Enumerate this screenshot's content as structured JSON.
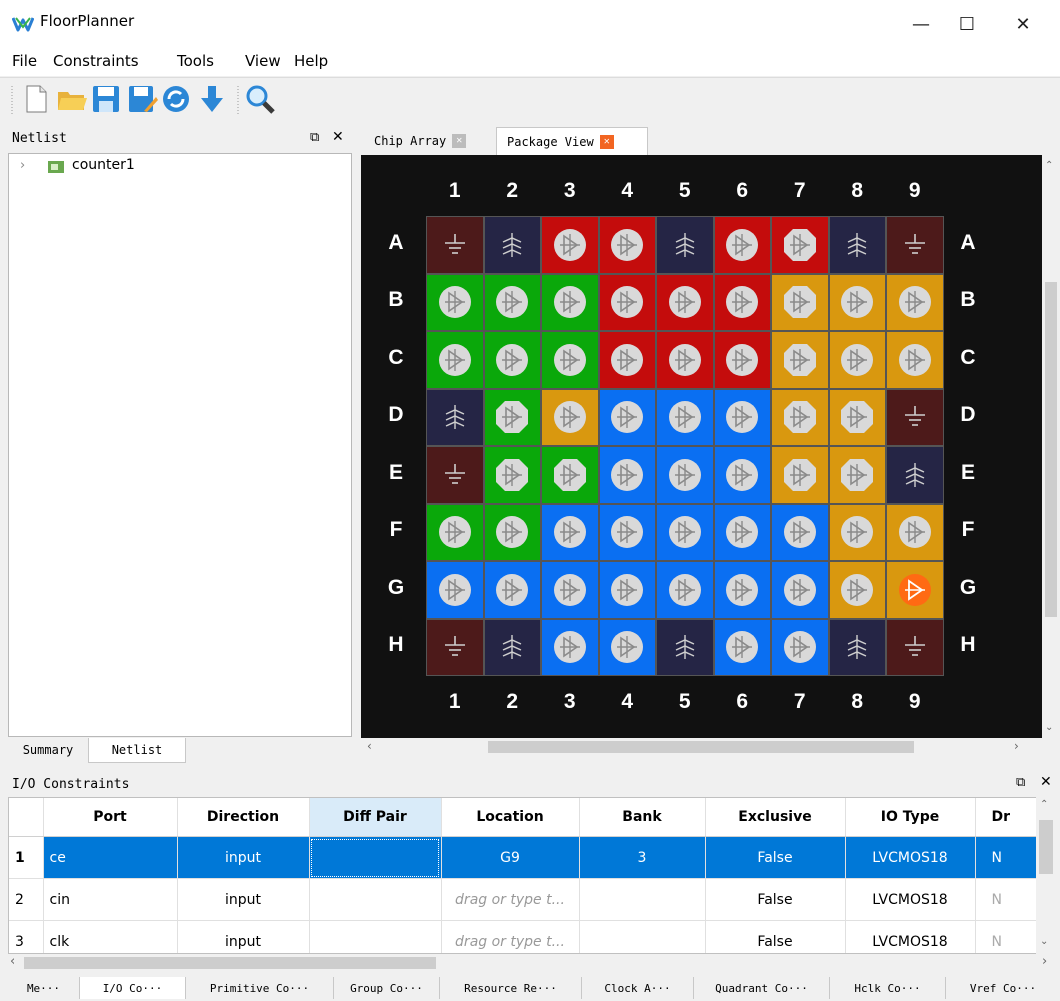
{
  "window": {
    "title": "FloorPlanner",
    "minimize": "—",
    "maximize": "☐",
    "close": "✕"
  },
  "menu": [
    "File",
    "Constraints",
    "Tools",
    "View",
    "Help"
  ],
  "toolbar": [
    "new-file",
    "open-folder",
    "save",
    "save-as",
    "refresh",
    "download",
    "search"
  ],
  "netlist": {
    "title": "Netlist",
    "root_item": "counter1",
    "tabs": [
      "Summary",
      "Netlist"
    ]
  },
  "view_tabs": [
    {
      "label": "Chip Array",
      "active": false
    },
    {
      "label": "Package View",
      "active": true
    }
  ],
  "package": {
    "columns": [
      "1",
      "2",
      "3",
      "4",
      "5",
      "6",
      "7",
      "8",
      "9"
    ],
    "rows": [
      "A",
      "B",
      "C",
      "D",
      "E",
      "F",
      "G",
      "H"
    ],
    "colors": {
      "g": "#4d1a1a",
      "v": "#252545",
      "r": "#c40c0c",
      "G": "#0aa80a",
      "y": "#d9980f",
      "b": "#0a6ff2",
      "o": "#d9980f"
    },
    "grid": [
      [
        "g:gnd",
        "v:pwr",
        "r:io",
        "r:io",
        "v:pwr",
        "r:io",
        "r:cfg",
        "v:pwr",
        "g:gnd"
      ],
      [
        "G:io",
        "G:io",
        "G:io",
        "r:io",
        "r:io",
        "r:io",
        "y:cfg",
        "y:io",
        "y:io"
      ],
      [
        "G:io",
        "G:io",
        "G:io",
        "r:io",
        "r:io",
        "r:io",
        "y:cfg",
        "y:io",
        "y:io"
      ],
      [
        "v:pwr",
        "G:cfg",
        "y:io",
        "b:io",
        "b:io",
        "b:io",
        "y:cfg",
        "y:cfg",
        "g:gnd"
      ],
      [
        "g:gnd",
        "G:cfg",
        "G:cfg",
        "b:io",
        "b:io",
        "b:io",
        "y:cfg",
        "y:cfg",
        "v:pwr"
      ],
      [
        "G:io",
        "G:io",
        "b:io",
        "b:io",
        "b:io",
        "b:io",
        "b:io",
        "y:io",
        "y:io"
      ],
      [
        "b:io",
        "b:io",
        "b:io",
        "b:io",
        "b:io",
        "b:io",
        "b:io",
        "y:io",
        "o:used"
      ],
      [
        "g:gnd",
        "v:pwr",
        "b:io",
        "b:io",
        "v:pwr",
        "b:io",
        "b:io",
        "v:pwr",
        "g:gnd"
      ]
    ]
  },
  "io_constraints": {
    "title": "I/O Constraints",
    "columns": [
      "Port",
      "Direction",
      "Diff Pair",
      "Location",
      "Bank",
      "Exclusive",
      "IO Type",
      "Dr"
    ],
    "rows": [
      {
        "num": "1",
        "port": "ce",
        "direction": "input",
        "diff": "",
        "location": "G9",
        "bank": "3",
        "exclusive": "False",
        "iotype": "LVCMOS18",
        "dr": "N"
      },
      {
        "num": "2",
        "port": "cin",
        "direction": "input",
        "diff": "",
        "location": "drag or type t...",
        "bank": "",
        "exclusive": "False",
        "iotype": "LVCMOS18",
        "dr": "N"
      },
      {
        "num": "3",
        "port": "clk",
        "direction": "input",
        "diff": "",
        "location": "drag or type t...",
        "bank": "",
        "exclusive": "False",
        "iotype": "LVCMOS18",
        "dr": "N"
      }
    ],
    "bottom_tabs": [
      "Me···",
      "I/O Co···",
      "Primitive Co···",
      "Group Co···",
      "Resource Re···",
      "Clock A···",
      "Quadrant Co···",
      "Hclk Co···",
      "Vref Co···"
    ]
  }
}
